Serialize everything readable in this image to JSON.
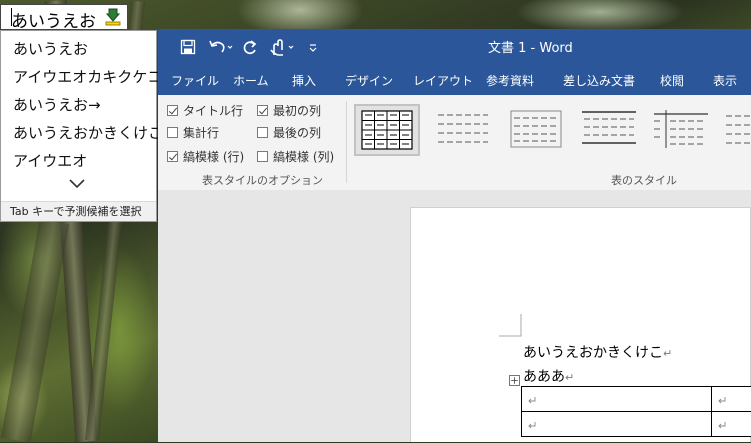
{
  "ime": {
    "composition": "あいうえお",
    "mode_icon": "ime-mode-icon",
    "candidates": [
      "あいうえお",
      "アイウエオカキクケコ",
      "あいうえお→",
      "あいうえおかきくけこ",
      "アイウエオ"
    ],
    "expand_icon": "chevron-down-icon",
    "footer": "Tab キーで予測候補を選択"
  },
  "word": {
    "title": "文書 1  -  Word",
    "qat": [
      "save-icon",
      "undo-icon",
      "redo-icon",
      "touch-mode-icon",
      "customize-qat-icon"
    ],
    "tabs": [
      "ファイル",
      "ホーム",
      "挿入",
      "デザイン",
      "レイアウト",
      "参考資料",
      "差し込み文書",
      "校閲",
      "表示"
    ],
    "table_style_options": {
      "items": [
        {
          "label": "タイトル行",
          "checked": true
        },
        {
          "label": "集計行",
          "checked": false
        },
        {
          "label": "縞模様 (行)",
          "checked": true
        },
        {
          "label": "最初の列",
          "checked": true
        },
        {
          "label": "最後の列",
          "checked": false
        },
        {
          "label": "縞模様 (列)",
          "checked": false
        }
      ],
      "group_label": "表スタイルのオプション"
    },
    "table_styles": {
      "group_label": "表のスタイル",
      "selected_index": 0
    },
    "document": {
      "lines": [
        "あいうえおかきくけこ",
        "あああ"
      ],
      "paragraph_mark": "↵"
    },
    "colors": {
      "title_bar": "#2b579a",
      "ribbon": "#f3f3f3",
      "canvas": "#e6e6e6"
    }
  }
}
